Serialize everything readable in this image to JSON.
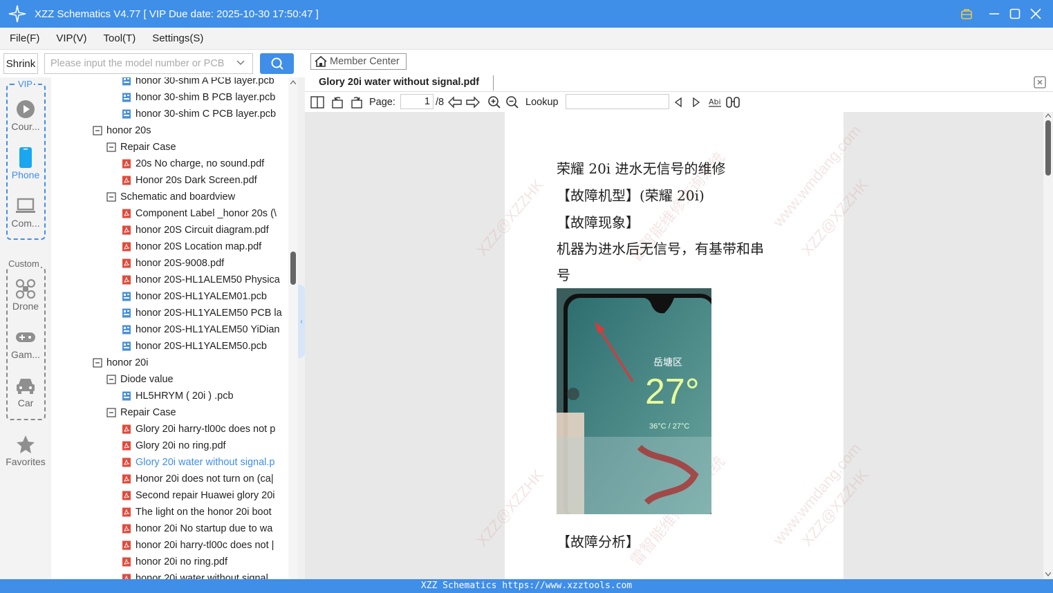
{
  "window": {
    "title": "XZZ Schematics V4.77 [ VIP Due date: 2025-10-30 17:50:47 ]",
    "accent": "#3f8ee8"
  },
  "menu": [
    "File(F)",
    "VIP(V)",
    "Tool(T)",
    "Settings(S)"
  ],
  "search": {
    "shrink_label": "Shrink",
    "placeholder": "Please input the model number or PCB"
  },
  "categories": {
    "vip_label": "VIP",
    "custom_label": "Custom",
    "items": [
      {
        "label": "Cour...",
        "icon": "play-icon"
      },
      {
        "label": "Phone",
        "icon": "phone-icon",
        "active": true
      },
      {
        "label": "Com...",
        "icon": "laptop-icon"
      },
      {
        "label": "Drone",
        "icon": "drone-icon"
      },
      {
        "label": "Gam...",
        "icon": "gamepad-icon"
      },
      {
        "label": "Car",
        "icon": "car-icon"
      },
      {
        "label": "Favorites",
        "icon": "star-icon"
      }
    ]
  },
  "tree": [
    {
      "level": 2,
      "type": "pcb",
      "label": "honor 30-shim A PCB layer.pcb"
    },
    {
      "level": 2,
      "type": "pcb",
      "label": "honor 30-shim B PCB layer.pcb"
    },
    {
      "level": 2,
      "type": "pcb",
      "label": "honor 30-shim C PCB layer.pcb"
    },
    {
      "level": 0,
      "type": "folder",
      "label": "honor 20s"
    },
    {
      "level": 1,
      "type": "folder",
      "label": "Repair Case"
    },
    {
      "level": 2,
      "type": "pdf",
      "label": "20s No charge, no sound.pdf"
    },
    {
      "level": 2,
      "type": "pdf",
      "label": "Honor 20s Dark Screen.pdf"
    },
    {
      "level": 1,
      "type": "folder",
      "label": "Schematic and boardview"
    },
    {
      "level": 2,
      "type": "pdf",
      "label": "Component Label _honor 20s (\\"
    },
    {
      "level": 2,
      "type": "pdf",
      "label": "honor 20S Circuit diagram.pdf"
    },
    {
      "level": 2,
      "type": "pdf",
      "label": "honor 20S Location map.pdf"
    },
    {
      "level": 2,
      "type": "pdf",
      "label": "honor 20S-9008.pdf"
    },
    {
      "level": 2,
      "type": "pdf",
      "label": "honor 20S-HL1ALEM50 Physica"
    },
    {
      "level": 2,
      "type": "pcb",
      "label": "honor 20S-HL1YALEM01.pcb"
    },
    {
      "level": 2,
      "type": "pcb",
      "label": "honor 20S-HL1YALEM50 PCB la"
    },
    {
      "level": 2,
      "type": "pcb",
      "label": "honor 20S-HL1YALEM50 YiDian"
    },
    {
      "level": 2,
      "type": "pcb",
      "label": "honor 20S-HL1YALEM50.pcb"
    },
    {
      "level": 0,
      "type": "folder",
      "label": "honor 20i"
    },
    {
      "level": 1,
      "type": "folder",
      "label": "Diode value"
    },
    {
      "level": 2,
      "type": "pcb",
      "label": "HL5HRYM ( 20i ) .pcb"
    },
    {
      "level": 1,
      "type": "folder",
      "label": "Repair Case"
    },
    {
      "level": 2,
      "type": "pdf",
      "label": "Glory 20i harry-tl00c does not p"
    },
    {
      "level": 2,
      "type": "pdf",
      "label": "Glory 20i no ring.pdf"
    },
    {
      "level": 2,
      "type": "pdf",
      "label": "Glory 20i water without signal.p",
      "selected": true
    },
    {
      "level": 2,
      "type": "pdf",
      "label": "Honor 20i does not turn on (ca|"
    },
    {
      "level": 2,
      "type": "pdf",
      "label": "Second repair Huawei glory 20i"
    },
    {
      "level": 2,
      "type": "pdf",
      "label": "The light on the honor 20i boot"
    },
    {
      "level": 2,
      "type": "pdf",
      "label": "honor 20i No startup due to wa"
    },
    {
      "level": 2,
      "type": "pdf",
      "label": "honor 20i harry-tl00c does not |"
    },
    {
      "level": 2,
      "type": "pdf",
      "label": "honor 20i no ring.pdf"
    },
    {
      "level": 2,
      "type": "pdf",
      "label": "honor 20i water without signal."
    }
  ],
  "viewer": {
    "member_center": "Member Center",
    "tab_title": "Glory 20i water without signal.pdf",
    "page_label": "Page:",
    "page_current": "1",
    "page_total": "/8",
    "lookup_label": "Lookup",
    "lookup_value": "",
    "doc_lines": [
      "荣耀 20i 进水无信号的维修",
      "【故障机型】(荣耀 20i)",
      "【故障现象】",
      "机器为进水后无信号，有基带和串",
      "号",
      "【故障分析】"
    ],
    "photo_text": {
      "district": "岳塘区",
      "temp": "27°",
      "range": "36°C / 27°C"
    },
    "watermarks": [
      "XZZ@XZZHK",
      "雷智能维修查询系统",
      "www.wmdang.com"
    ]
  },
  "status": "XZZ Schematics https://www.xzztools.com"
}
